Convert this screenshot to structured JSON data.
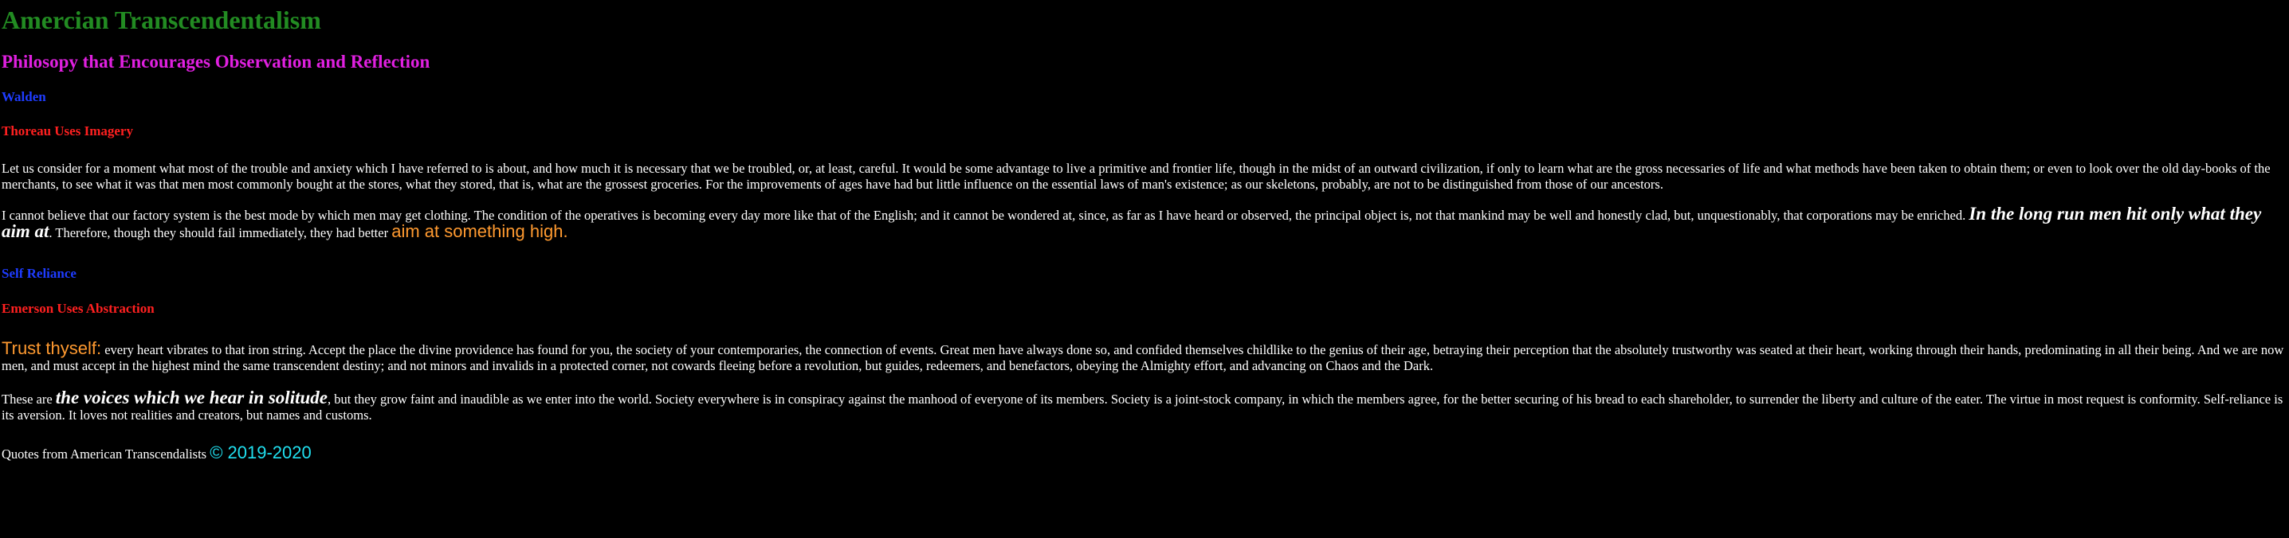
{
  "header": {
    "title": "Amercian Transcendentalism",
    "subtitle": "Philosopy that Encourages Observation and Reflection"
  },
  "sections": [
    {
      "heading": "Walden",
      "subheading": "Thoreau Uses Imagery",
      "paragraph1": "Let us consider for a moment what most of the trouble and anxiety which I have referred to is about, and how much it is necessary that we be troubled, or, at least, careful. It would be some advantage to live a primitive and frontier life, though in the midst of an outward civilization, if only to learn what are the gross necessaries of life and what methods have been taken to obtain them; or even to look over the old day-books of the merchants, to see what it was that men most commonly bought at the stores, what they stored, that is, what are the grossest groceries. For the improvements of ages have had but little influence on the essential laws of man's existence; as our skeletons, probably, are not to be distinguished from those of our ancestors.",
      "paragraph2_before": "I cannot believe that our factory system is the best mode by which men may get clothing. The condition of the operatives is becoming every day more like that of the English; and it cannot be wondered at, since, as far as I have heard or observed, the principal object is, not that mankind may be well and honestly clad, but, unquestionably, that corporations may be enriched. ",
      "paragraph2_quote": "In the long run men hit only what they aim at",
      "paragraph2_middle": ". Therefore, though they should fail immediately, they had better ",
      "paragraph2_highlight": "aim at something high."
    },
    {
      "heading": "Self Reliance",
      "subheading": "Emerson Uses Abstraction",
      "paragraph1_highlight": "Trust thyself:",
      "paragraph1_rest": " every heart vibrates to that iron string. Accept the place the divine providence has found for you, the society of your contemporaries, the connection of events. Great men have always done so, and confided themselves childlike to the genius of their age, betraying their perception that the absolutely trustworthy was seated at their heart, working through their hands, predominating in all their being. And we are now men, and must accept in the highest mind the same transcendent destiny; and not minors and invalids in a protected corner, not cowards fleeing before a revolution, but guides, redeemers, and benefactors, obeying the Almighty effort, and advancing on Chaos and the Dark.",
      "paragraph2_before": "These are ",
      "paragraph2_quote": "the voices which we hear in solitude",
      "paragraph2_rest": ", but they grow faint and inaudible as we enter into the world. Society everywhere is in conspiracy against the manhood of everyone of its members. Society is a joint-stock company, in which the members agree, for the better securing of his bread to each shareholder, to surrender the liberty and culture of the eater. The virtue in most request is conformity. Self-reliance is its aversion. It loves not realities and creators, but names and customs."
    }
  ],
  "footer": {
    "text": "Quotes from American Transcendalists ",
    "copyright": "© 2019-2020"
  },
  "colors": {
    "title": "#228b22",
    "subtitle": "#e020e0",
    "section_heading": "#1e3cff",
    "section_subheading": "#ff2020",
    "highlight": "#ff9a30",
    "copyright": "#20e0f0",
    "background": "#000000"
  }
}
